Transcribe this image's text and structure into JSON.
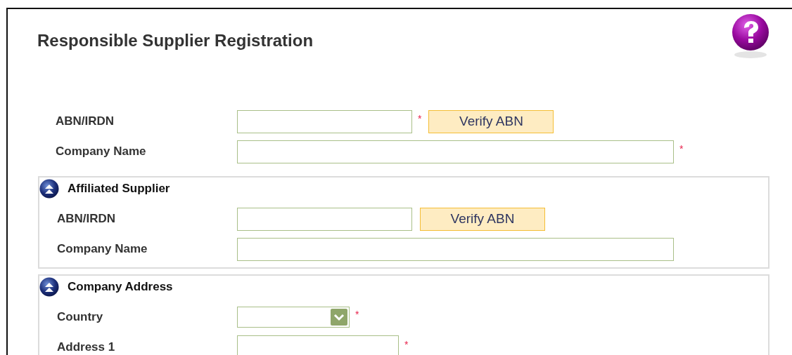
{
  "title": "Responsible Supplier Registration",
  "fields": [
    {
      "kind": "short-text",
      "label": "ABN/IRDN",
      "required_mark": "*",
      "button": "Verify ABN"
    },
    {
      "kind": "long-text",
      "label": "Company Name",
      "required_mark": "*"
    }
  ],
  "sections": [
    {
      "title": "Affiliated Supplier",
      "expanded": true,
      "fields": [
        {
          "kind": "short-text",
          "label": "ABN/IRDN",
          "button": "Verify ABN"
        },
        {
          "kind": "long-text",
          "label": "Company Name"
        }
      ]
    },
    {
      "title": "Company Address",
      "expanded": true,
      "fields": [
        {
          "kind": "select",
          "label": "Country",
          "required_mark": "*"
        },
        {
          "kind": "medium-text",
          "label": "Address 1",
          "required_mark": "*"
        }
      ]
    }
  ]
}
